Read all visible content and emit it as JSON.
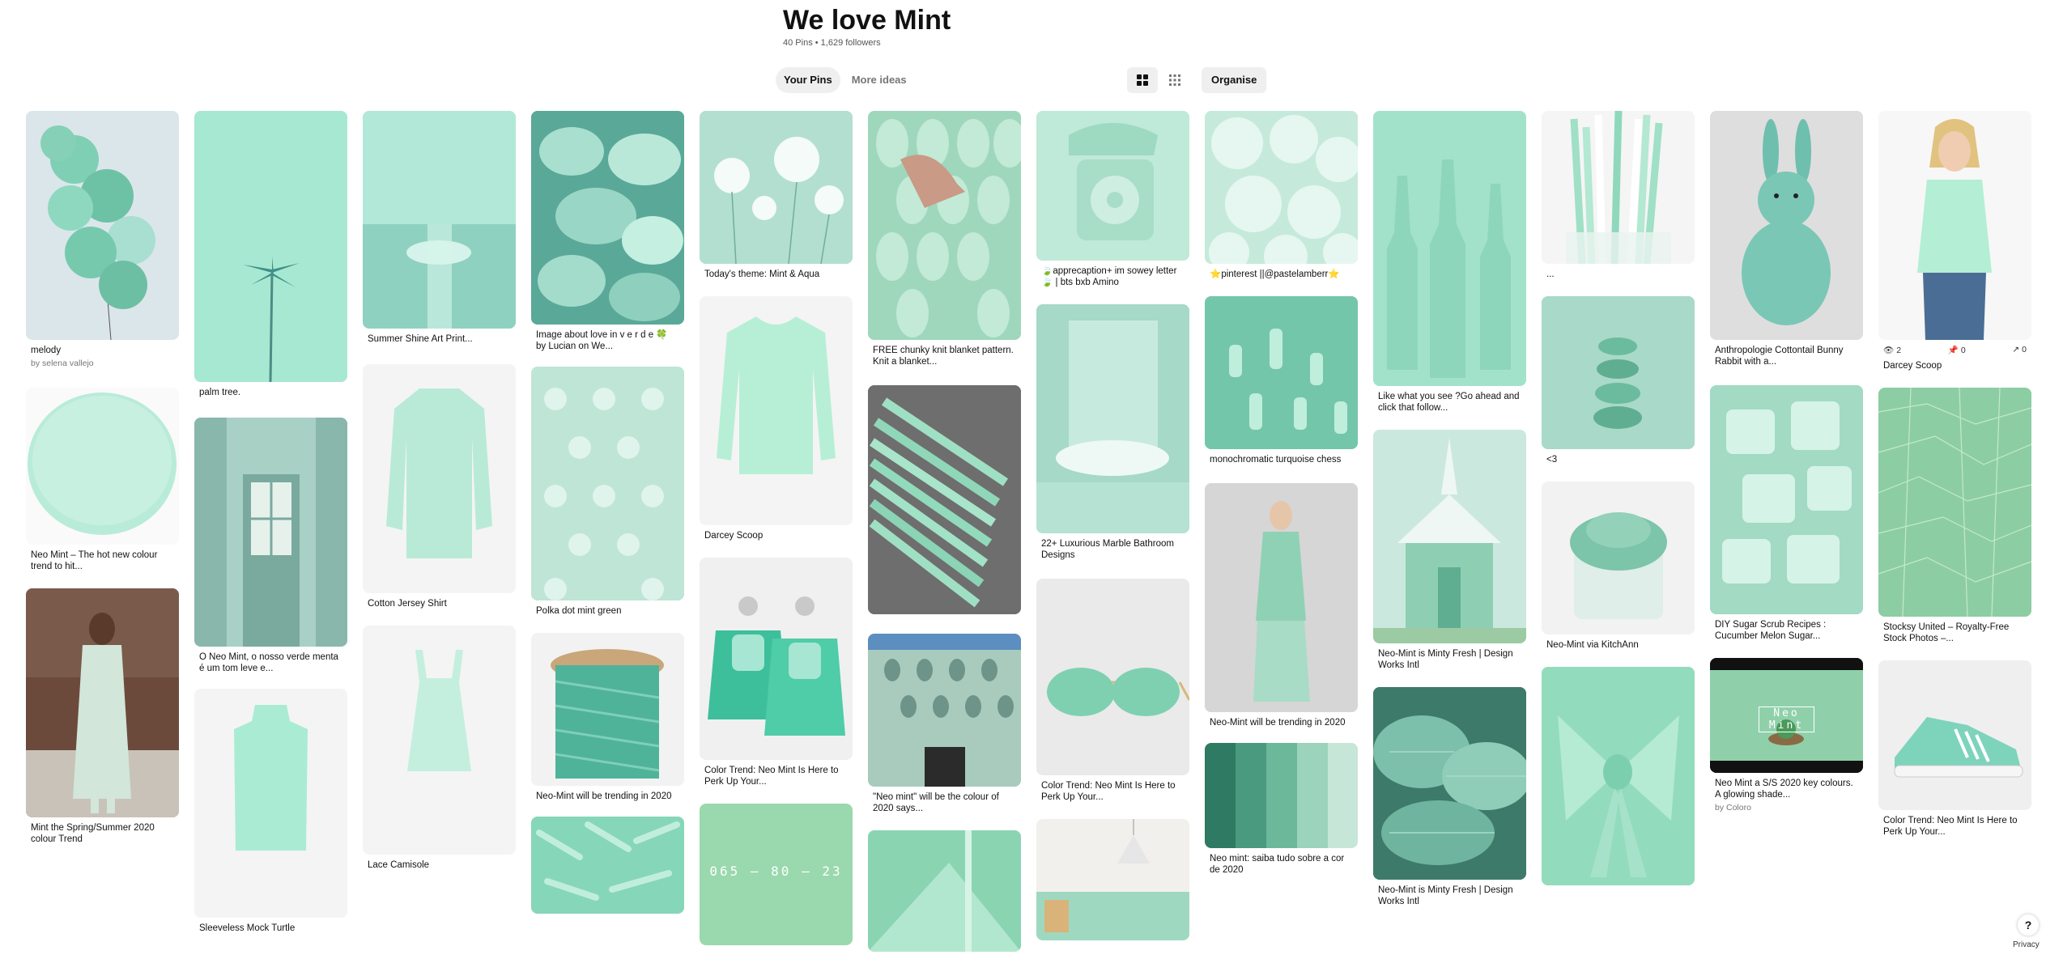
{
  "board": {
    "title": "We love Mint",
    "stats": "40 Pins • 1,629 followers"
  },
  "tabs": [
    {
      "label": "Your Pins",
      "active": true
    },
    {
      "label": "More ideas",
      "active": false
    }
  ],
  "view": {
    "organise_label": "Organise"
  },
  "footer": {
    "help_label": "?",
    "privacy_label": "Privacy"
  },
  "pins": {
    "p1": {
      "title": "melody",
      "sub": "by selena vallejo"
    },
    "p2": {
      "title": "Neo Mint – The hot new colour trend to hit..."
    },
    "p3": {
      "title": "Mint the Spring/Summer 2020 colour Trend"
    },
    "p4": {
      "title": "palm tree."
    },
    "p5": {
      "title": "O Neo Mint, o nosso verde menta é um tom leve e..."
    },
    "p6": {
      "title": "Sleeveless Mock Turtle"
    },
    "p7": {
      "title": "Summer Shine Art Print..."
    },
    "p8": {
      "title": "Cotton Jersey Shirt"
    },
    "p9": {
      "title": "Lace Camisole"
    },
    "p10": {
      "title": "Image about love in v e r d e 🍀 by Lucian on We..."
    },
    "p11": {
      "title": "Polka dot mint green"
    },
    "p12": {
      "title": "Neo-Mint will be trending in 2020"
    },
    "p13": {
      "title": "Today's theme: Mint & Aqua"
    },
    "p14": {
      "title": "Darcey Scoop"
    },
    "p15": {
      "title": "Color Trend: Neo Mint Is Here to Perk Up Your..."
    },
    "p16": {
      "overlay": "065 — 80 — 23"
    },
    "p17": {
      "title": "FREE chunky knit blanket pattern. Knit a blanket..."
    },
    "p18": {
      "title": "\"Neo mint\" will be the colour of 2020 says..."
    },
    "p19": {
      "title": "🍃apprecaption+ im sowey letter🍃 | bts bxb Amino"
    },
    "p20": {
      "title": "22+ Luxurious Marble Bathroom Designs"
    },
    "p21": {
      "title": "Color Trend: Neo Mint Is Here to Perk Up Your..."
    },
    "p22": {
      "title": "⭐pinterest ||@pastelamberr⭐"
    },
    "p23": {
      "title": "monochromatic turquoise chess"
    },
    "p24": {
      "title": "Neo-Mint will be trending in 2020"
    },
    "p25": {
      "title": "Neo mint: saiba tudo sobre a cor de 2020"
    },
    "p26": {
      "title": "Like what you see ?Go ahead and click that follow..."
    },
    "p27": {
      "title": "Neo-Mint is Minty Fresh | Design Works Intl"
    },
    "p28": {
      "title": "Neo-Mint is Minty Fresh | Design Works Intl"
    },
    "p29": {
      "title": "..."
    },
    "p30": {
      "title": "<3"
    },
    "p31": {
      "title": "Neo-Mint via KitchAnn"
    },
    "p32": {
      "title": "Anthropologie Cottontail Bunny Rabbit with a..."
    },
    "p33": {
      "title": "DIY Sugar Scrub Recipes : Cucumber Melon Sugar..."
    },
    "p34": {
      "title": "Neo Mint a S/S 2020 key colours. A glowing shade...",
      "sub": "by Coloro",
      "overlay": "Neo Mint"
    },
    "p35": {
      "title": "Darcey Scoop",
      "views": "2",
      "saves": "0",
      "shares": "0"
    },
    "p36": {
      "title": "Stocksy United – Royalty-Free Stock Photos –..."
    },
    "p37": {
      "title": "Color Trend: Neo Mint Is Here to Perk Up Your..."
    }
  }
}
